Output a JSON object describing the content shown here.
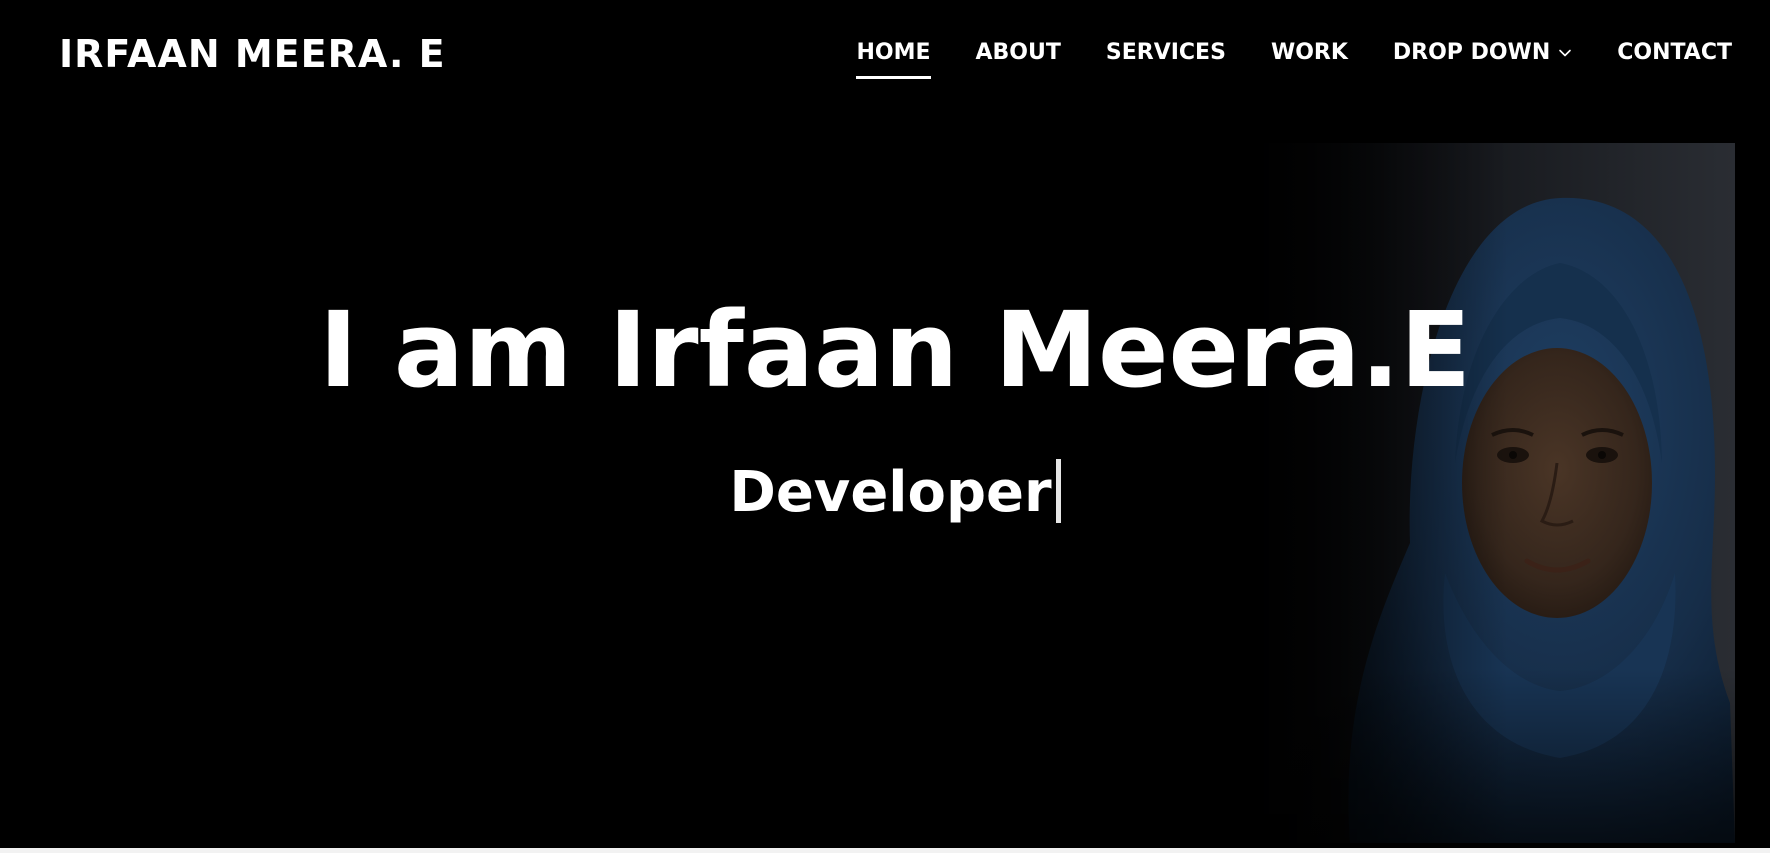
{
  "header": {
    "logo": "IRFAAN MEERA. E",
    "nav": [
      {
        "label": "HOME",
        "active": true
      },
      {
        "label": "ABOUT"
      },
      {
        "label": "SERVICES"
      },
      {
        "label": "WORK"
      },
      {
        "label": "DROP DOWN",
        "icon": "chevron-down-icon"
      },
      {
        "label": "CONTACT"
      }
    ]
  },
  "hero": {
    "title": "I am Irfaan Meera.E",
    "subtitle": "Developer",
    "cursor": "|"
  },
  "colors": {
    "background": "#000000",
    "text": "#ffffff",
    "hijab": "#1c3a5c",
    "skin": "#3a2a20"
  }
}
